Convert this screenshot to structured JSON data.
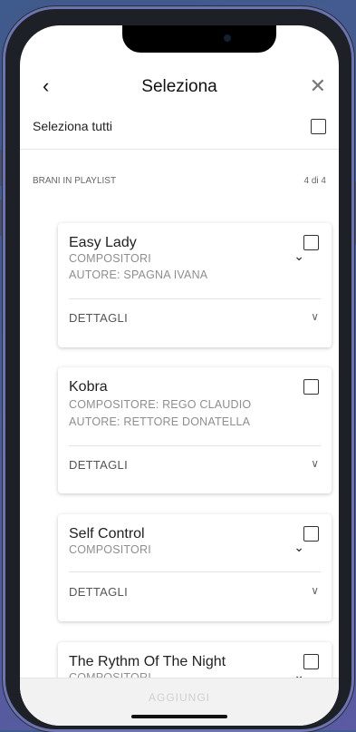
{
  "header": {
    "back_icon": "chevron-left-icon",
    "back_glyph": "‹",
    "title": "Seleziona",
    "close_icon": "close-icon",
    "close_glyph": "✕"
  },
  "select_all": {
    "label": "Seleziona tutti",
    "checked": false
  },
  "section": {
    "label": "BRANI IN PLAYLIST",
    "count": "4 di 4"
  },
  "songs": [
    {
      "title": "Easy Lady",
      "line1": "COMPOSITORI",
      "line2": "AUTORE: SPAGNA IVANA",
      "details": "DETTAGLI",
      "checked": false
    },
    {
      "title": "Kobra",
      "line1": "COMPOSITORE: REGO CLAUDIO",
      "line2": "AUTORE: RETTORE DONATELLA",
      "details": "DETTAGLI",
      "checked": false
    },
    {
      "title": "Self Control",
      "line1": "COMPOSITORI",
      "details": "DETTAGLI",
      "checked": false
    },
    {
      "title": "The Rythm Of The Night",
      "line1": "COMPOSITORI",
      "checked": false
    }
  ],
  "chevron_down_glyph": "⌄",
  "details_chevron_glyph": "∨",
  "bottom": {
    "add_label": "AGGIUNGI"
  },
  "colors": {
    "accent_frame": "#6b73b0",
    "background": "#4b5d96"
  }
}
